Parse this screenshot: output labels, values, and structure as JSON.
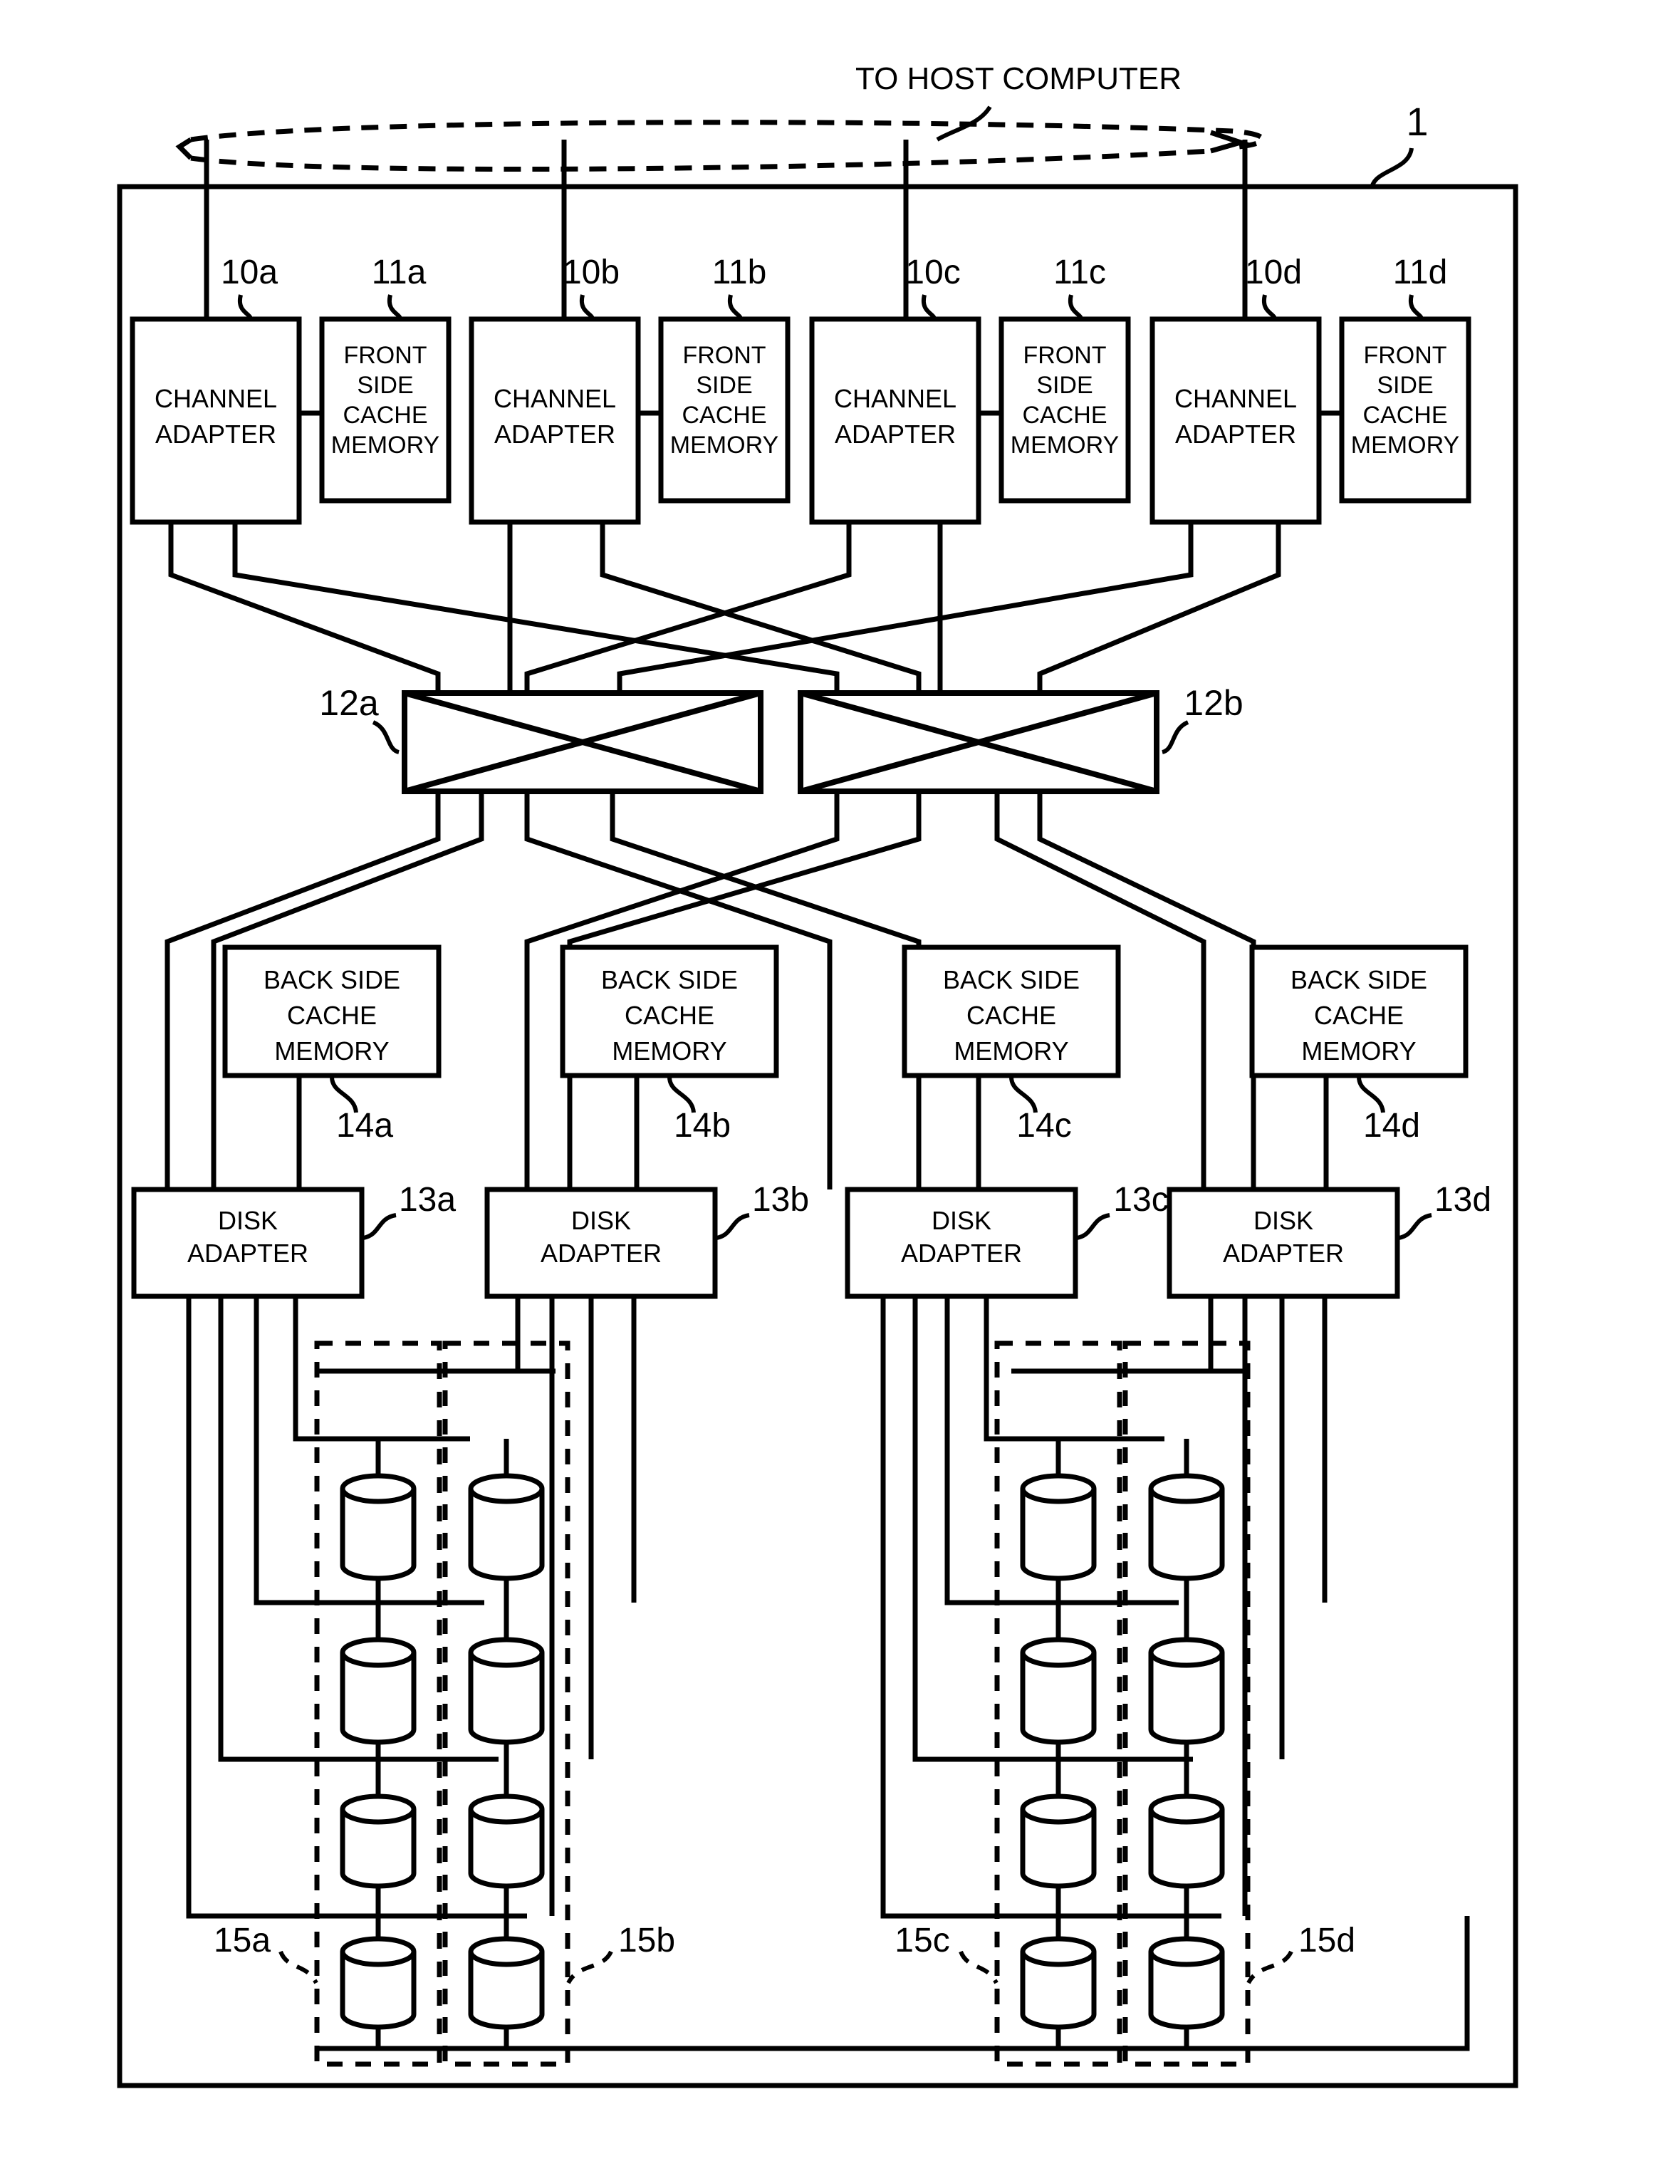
{
  "figure": {
    "caption_top": "TO HOST COMPUTER",
    "system_ref": "1",
    "background_color": "#ffffff",
    "line_color": "#000000"
  },
  "channel_adapters": [
    {
      "ref": "10a",
      "line1": "CHANNEL",
      "line2": "ADAPTER"
    },
    {
      "ref": "10b",
      "line1": "CHANNEL",
      "line2": "ADAPTER"
    },
    {
      "ref": "10c",
      "line1": "CHANNEL",
      "line2": "ADAPTER"
    },
    {
      "ref": "10d",
      "line1": "CHANNEL",
      "line2": "ADAPTER"
    }
  ],
  "front_side_cache_memories": [
    {
      "ref": "11a",
      "line1": "FRONT",
      "line2": "SIDE",
      "line3": "CACHE",
      "line4": "MEMORY"
    },
    {
      "ref": "11b",
      "line1": "FRONT",
      "line2": "SIDE",
      "line3": "CACHE",
      "line4": "MEMORY"
    },
    {
      "ref": "11c",
      "line1": "FRONT",
      "line2": "SIDE",
      "line3": "CACHE",
      "line4": "MEMORY"
    },
    {
      "ref": "11d",
      "line1": "FRONT",
      "line2": "SIDE",
      "line3": "CACHE",
      "line4": "MEMORY"
    }
  ],
  "switches": [
    {
      "ref": "12a"
    },
    {
      "ref": "12b"
    }
  ],
  "back_side_cache_memories": [
    {
      "ref": "14a",
      "line1": "BACK SIDE",
      "line2": "CACHE",
      "line3": "MEMORY"
    },
    {
      "ref": "14b",
      "line1": "BACK SIDE",
      "line2": "CACHE",
      "line3": "MEMORY"
    },
    {
      "ref": "14c",
      "line1": "BACK SIDE",
      "line2": "CACHE",
      "line3": "MEMORY"
    },
    {
      "ref": "14d",
      "line1": "BACK SIDE",
      "line2": "CACHE",
      "line3": "MEMORY"
    }
  ],
  "disk_adapters": [
    {
      "ref": "13a",
      "line1": "DISK",
      "line2": "ADAPTER"
    },
    {
      "ref": "13b",
      "line1": "DISK",
      "line2": "ADAPTER"
    },
    {
      "ref": "13c",
      "line1": "DISK",
      "line2": "ADAPTER"
    },
    {
      "ref": "13d",
      "line1": "DISK",
      "line2": "ADAPTER"
    }
  ],
  "disk_groups": [
    {
      "ref": "15a",
      "drive_count": 4
    },
    {
      "ref": "15b",
      "drive_count": 4
    },
    {
      "ref": "15c",
      "drive_count": 4
    },
    {
      "ref": "15d",
      "drive_count": 4
    }
  ]
}
